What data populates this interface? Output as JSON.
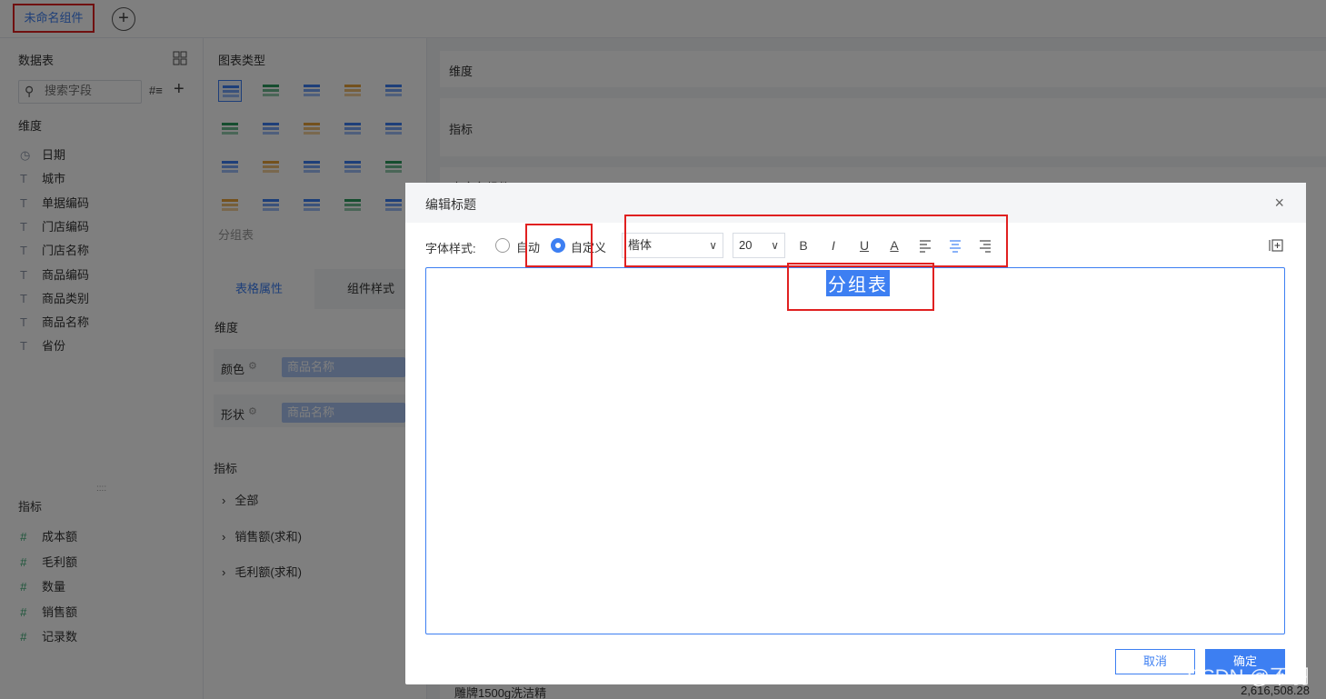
{
  "tabs": {
    "active_label": "未命名组件",
    "add_symbol": "+"
  },
  "left": {
    "datatable_title": "数据表",
    "search_placeholder": "搜索字段",
    "dimension_title": "维度",
    "dimensions": [
      {
        "icon": "◷",
        "label": "日期"
      },
      {
        "icon": "T",
        "label": "城市"
      },
      {
        "icon": "T",
        "label": "单据编码"
      },
      {
        "icon": "T",
        "label": "门店编码"
      },
      {
        "icon": "T",
        "label": "门店名称"
      },
      {
        "icon": "T",
        "label": "商品编码"
      },
      {
        "icon": "T",
        "label": "商品类别"
      },
      {
        "icon": "T",
        "label": "商品名称"
      },
      {
        "icon": "T",
        "label": "省份"
      }
    ],
    "measure_title": "指标",
    "measures": [
      {
        "icon": "#",
        "label": "成本额"
      },
      {
        "icon": "#",
        "label": "毛利额"
      },
      {
        "icon": "#",
        "label": "数量"
      },
      {
        "icon": "#",
        "label": "销售额"
      },
      {
        "icon": "#",
        "label": "记录数"
      }
    ]
  },
  "mid": {
    "chart_type_title": "图表类型",
    "chart_type_selected_label": "分组表",
    "tab_table_props": "表格属性",
    "tab_component_style": "组件样式",
    "dimension_title": "维度",
    "color_label": "颜色",
    "color_value": "商品名称",
    "shape_label": "形状",
    "shape_value": "商品名称",
    "measure_title": "指标",
    "measure_items": [
      "全部",
      "销售额(求和)",
      "毛利额(求和)"
    ]
  },
  "right": {
    "dimension_label": "维度",
    "measure_label": "指标",
    "peek_label": "未命名组件",
    "bottom_row_label": "雕牌1500g洗洁精",
    "bottom_row_value": "2,616,508.28"
  },
  "dialog": {
    "title": "编辑标题",
    "close_symbol": "×",
    "font_style_label": "字体样式:",
    "radio_auto": "自动",
    "radio_custom": "自定义",
    "font_family": "楷体",
    "font_size": "20",
    "toolbar": {
      "bold": "B",
      "italic": "I",
      "underline": "U",
      "color": "A"
    },
    "editor_text": "分组表",
    "cancel_label": "取消",
    "ok_label": "确定"
  },
  "watermark": "CSDN @不羽",
  "colors": {
    "accent": "#3d7ff2",
    "highlight_box": "#e02020"
  }
}
